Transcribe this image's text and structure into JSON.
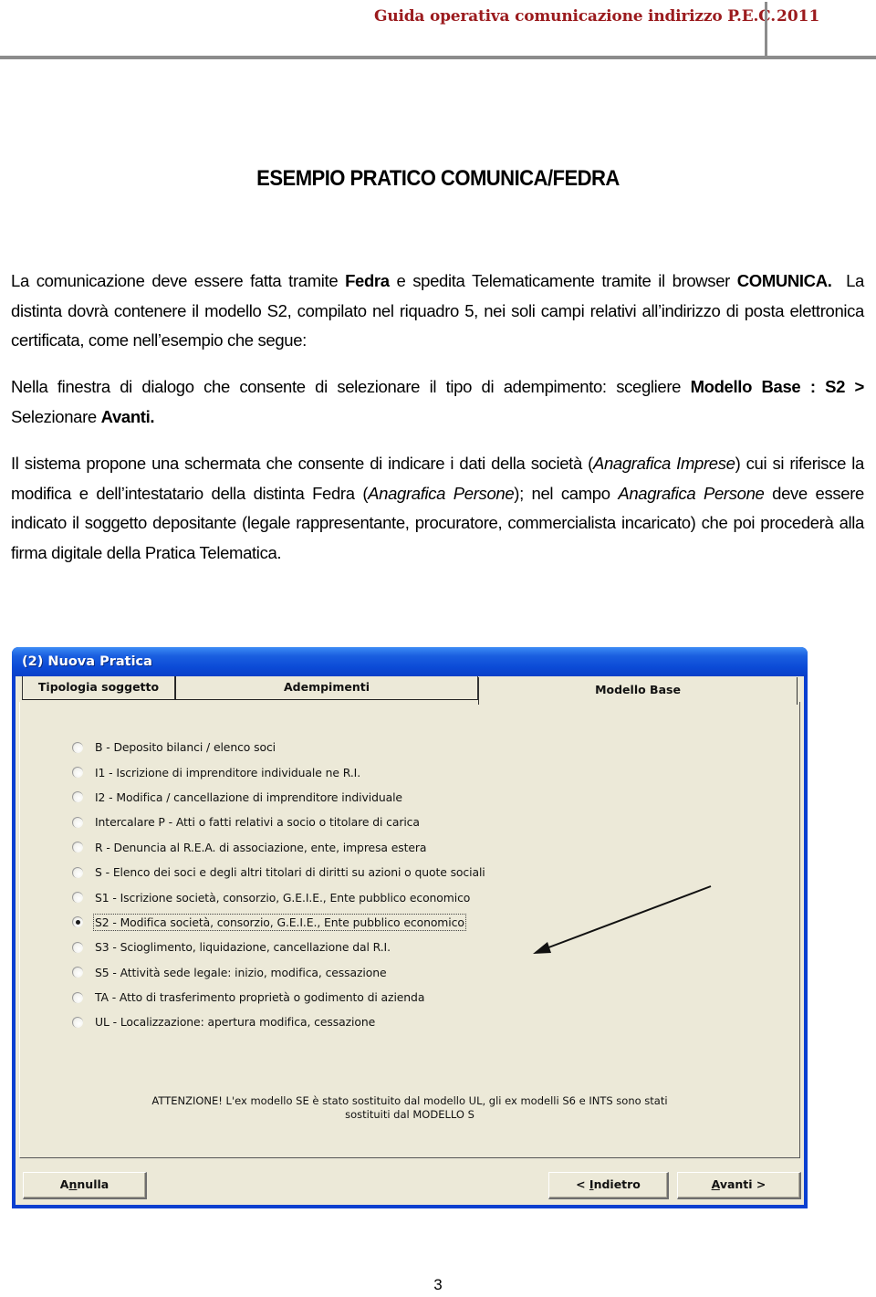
{
  "header": {
    "title": "Guida operativa comunicazione indirizzo P.E.C.",
    "year": "2011",
    "color": "#9b1b1e"
  },
  "document": {
    "title": "ESEMPIO PRATICO COMUNICA/FEDRA",
    "p1": {
      "a": "La comunicazione deve essere fatta tramite ",
      "b": "Fedra",
      "c": " e spedita Telematicamente tramite il browser ",
      "d": "COMUNICA.",
      "e": "  La distinta dovrà contenere il modello S2, compilato nel riquadro 5, nei soli campi relativi all’indirizzo di posta elettronica certificata, come nell’esempio che segue:"
    },
    "p2": {
      "a": "Nella finestra di dialogo che consente di selezionare il tipo di adempimento: scegliere ",
      "b": "Modello Base : S2 >",
      "c": " Selezionare ",
      "d": "Avanti."
    },
    "p3": {
      "a": "Il sistema propone una schermata che consente di indicare i dati della società (",
      "b": "Anagrafica Imprese",
      "c": ") cui si riferisce la modifica e dell’intestatario della distinta Fedra (",
      "d": "Anagrafica Persone",
      "e": "); nel campo ",
      "f": "Anagrafica Persone",
      "g": " deve essere indicato il soggetto depositante (legale rappresentante, procuratore, commercialista incaricato) che poi procederà alla firma digitale della Pratica Telematica."
    },
    "page_number": "3"
  },
  "dialog": {
    "title": "(2) Nuova Pratica",
    "tabs": [
      {
        "label": "Tipologia soggetto",
        "active": false
      },
      {
        "label": "Adempimenti",
        "active": false
      },
      {
        "label": "Modello Base",
        "active": true
      }
    ],
    "options": [
      {
        "label": "B - Deposito bilanci / elenco soci",
        "checked": false
      },
      {
        "label": "I1 - Iscrizione di imprenditore individuale ne R.I.",
        "checked": false
      },
      {
        "label": "I2 - Modifica / cancellazione di imprenditore individuale",
        "checked": false
      },
      {
        "label": "Intercalare P - Atti o fatti relativi a socio o titolare di carica",
        "checked": false
      },
      {
        "label": "R - Denuncia al R.E.A. di associazione, ente, impresa estera",
        "checked": false
      },
      {
        "label": "S - Elenco dei soci e degli altri titolari di diritti su azioni o quote sociali",
        "checked": false
      },
      {
        "label": "S1 - Iscrizione società, consorzio, G.E.I.E., Ente pubblico economico",
        "checked": false
      },
      {
        "label": "S2 - Modifica società, consorzio, G.E.I.E., Ente pubblico economico",
        "checked": true
      },
      {
        "label": "S3 - Scioglimento, liquidazione, cancellazione dal R.I.",
        "checked": false
      },
      {
        "label": "S5 - Attività sede legale: inizio, modifica, cessazione",
        "checked": false
      },
      {
        "label": "TA - Atto di trasferimento proprietà o godimento di azienda",
        "checked": false
      },
      {
        "label": "UL - Localizzazione: apertura modifica, cessazione",
        "checked": false
      }
    ],
    "warning": {
      "line1": "ATTENZIONE! L'ex modello SE è stato sostituito dal modello UL, gli ex modelli S6 e INTS sono stati",
      "line2": "sostituiti dal MODELLO S"
    },
    "buttons": {
      "cancel": {
        "pre": "A",
        "u": "n",
        "post": "nulla"
      },
      "back": {
        "pre": "< ",
        "u": "I",
        "post": "ndietro"
      },
      "next": {
        "pre": "",
        "u": "A",
        "post": "vanti >"
      }
    }
  }
}
